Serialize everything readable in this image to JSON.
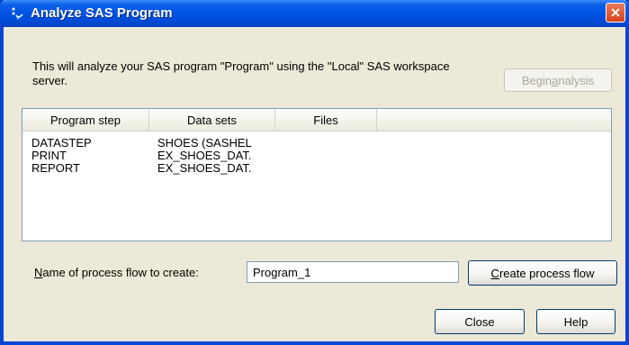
{
  "window": {
    "title": "Analyze SAS Program",
    "close_glyph": "✕"
  },
  "description": "This will analyze your SAS program \"Program\" using the \"Local\" SAS workspace server.",
  "begin_button": {
    "pre": "Begin ",
    "accel": "a",
    "post": "nalysis",
    "enabled": false
  },
  "listview": {
    "columns": [
      "Program step",
      "Data sets",
      "Files"
    ],
    "rows": [
      {
        "step": "DATASTEP",
        "datasets": "SHOES (SASHEL",
        "files": ""
      },
      {
        "step": "PRINT",
        "datasets": "EX_SHOES_DAT.",
        "files": ""
      },
      {
        "step": "REPORT",
        "datasets": "EX_SHOES_DAT.",
        "files": ""
      }
    ]
  },
  "name_field": {
    "label_accel": "N",
    "label_rest": "ame of process flow to create:",
    "value": "Program_1"
  },
  "create_button": {
    "accel": "C",
    "rest": "reate process flow"
  },
  "close_button": "Close",
  "help_button": "Help",
  "colors": {
    "titlebar": "#0054e3",
    "dialog_bg": "#ece9d8",
    "close_red": "#d8401c"
  }
}
